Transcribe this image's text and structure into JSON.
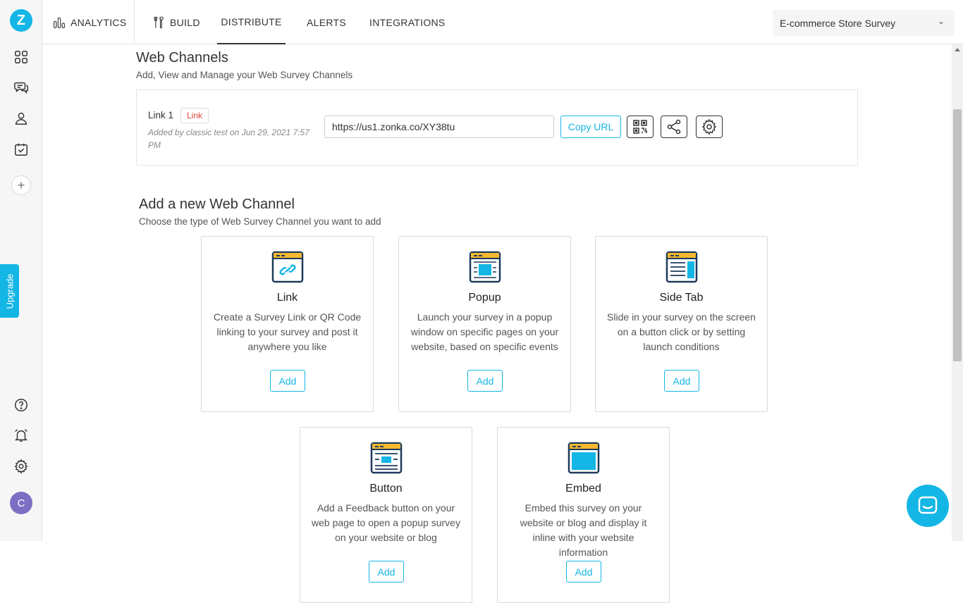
{
  "sidebar": {
    "logo": "Z",
    "upgrade_label": "Upgrade",
    "avatar_initial": "C",
    "plus": "+"
  },
  "nav": {
    "analytics": "ANALYTICS",
    "build": "BUILD",
    "distribute": "DISTRIBUTE",
    "alerts": "ALERTS",
    "integrations": "INTEGRATIONS",
    "survey_selected": "E-commerce Store Survey"
  },
  "web_channels": {
    "title": "Web Channels",
    "subtitle": "Add, View and Manage your Web Survey Channels",
    "channel": {
      "name": "Link 1",
      "badge": "Link",
      "meta": "Added by classic test on Jun 29, 2021 7:57 PM",
      "url": "https://us1.zonka.co/XY38tu",
      "copy_label": "Copy URL"
    }
  },
  "add_channel": {
    "title": "Add a new Web Channel",
    "subtitle": "Choose the type of Web Survey Channel you want to add",
    "cards": [
      {
        "title": "Link",
        "desc": "Create a Survey Link or QR Code linking to your survey and post it anywhere you like",
        "add": "Add"
      },
      {
        "title": "Popup",
        "desc": "Launch your survey in a popup window on specific pages on your website, based on specific events",
        "add": "Add"
      },
      {
        "title": "Side Tab",
        "desc": "Slide in your survey on the screen on a button click or by setting launch conditions",
        "add": "Add"
      },
      {
        "title": "Button",
        "desc": "Add a Feedback button on your web page to open a popup survey on your website or blog",
        "add": "Add"
      },
      {
        "title": "Embed",
        "desc": "Embed this survey on your website or blog and display it inline with your website information",
        "add": "Add"
      }
    ]
  },
  "colors": {
    "accent": "#14b6e5",
    "badge_red": "#e0453a",
    "icon_yellow": "#f5b82e",
    "icon_navy": "#1e3a5c"
  }
}
